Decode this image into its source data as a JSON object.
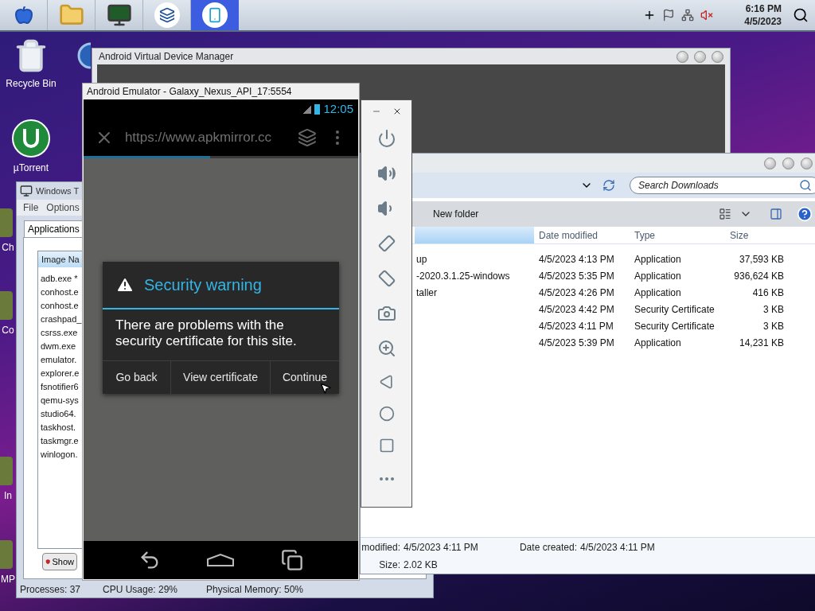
{
  "taskbar": {
    "apps": [
      {
        "kind": "apple",
        "selected": false
      },
      {
        "kind": "folder",
        "selected": false
      },
      {
        "kind": "monitor",
        "selected": false
      },
      {
        "kind": "studio",
        "selected": false
      },
      {
        "kind": "phone",
        "selected": true
      }
    ],
    "time": "6:16 PM",
    "date": "4/5/2023"
  },
  "desktop_icons": [
    {
      "kind": "recycle-bin",
      "label": "Recycle Bin"
    },
    {
      "kind": "torrent",
      "label": "µTorrent"
    },
    {
      "kind": "app",
      "label": "Ch"
    },
    {
      "kind": "app",
      "label": "Co"
    },
    {
      "kind": "app",
      "label": "In"
    },
    {
      "kind": "app",
      "label": "MP"
    }
  ],
  "avd_manager": {
    "title": "Android Virtual Device Manager"
  },
  "task_manager": {
    "title": "Windows T",
    "menu": [
      "File",
      "Options"
    ],
    "tabs": [
      {
        "label": "Applications",
        "selected": true
      }
    ],
    "column": "Image Na",
    "processes": [
      "adb.exe *",
      "conhost.e",
      "conhost.e",
      "crashpad_",
      "csrss.exe",
      "dwm.exe",
      "emulator.",
      "explorer.e",
      "fsnotifier6",
      "qemu-sys",
      "studio64.",
      "taskhost.",
      "taskmgr.e",
      "winlogon."
    ],
    "show_button": "Show",
    "status": [
      "Processes: 37",
      "CPU Usage: 29%",
      "Physical Memory: 50%"
    ]
  },
  "explorer": {
    "search_placeholder": "Search Downloads",
    "toolbar": [
      "New folder"
    ],
    "columns": [
      "Date modified",
      "Type",
      "Size"
    ],
    "rows": [
      {
        "name": "up",
        "date": "4/5/2023 4:13 PM",
        "type": "Application",
        "size": "37,593 KB"
      },
      {
        "name": "-2020.3.1.25-windows",
        "date": "4/5/2023 5:35 PM",
        "type": "Application",
        "size": "936,624 KB"
      },
      {
        "name": "taller",
        "date": "4/5/2023 4:26 PM",
        "type": "Application",
        "size": "416 KB"
      },
      {
        "date": "4/5/2023 4:42 PM",
        "type": "Security Certificate",
        "size": "3 KB"
      },
      {
        "date": "4/5/2023 4:11 PM",
        "type": "Security Certificate",
        "size": "3 KB"
      },
      {
        "date": "4/5/2023 5:39 PM",
        "type": "Application",
        "size": "14,231 KB"
      }
    ],
    "details": [
      {
        "label": "modified:",
        "value": "4/5/2023 4:11 PM"
      },
      {
        "label": "Date created:",
        "value": "4/5/2023 4:11 PM"
      },
      {
        "label": "Size:",
        "value": "2.02 KB"
      }
    ]
  },
  "emulator": {
    "title": "Android Emulator - Galaxy_Nexus_API_17:5554",
    "clock": "12:05",
    "url": "https://www.apkmirror.cc",
    "page_load": {
      "level": 0.46
    },
    "dialog": {
      "title": "Security warning",
      "message": "There are problems with the security certificate for this site.",
      "buttons": [
        "Go back",
        "View certificate",
        "Continue"
      ]
    }
  }
}
